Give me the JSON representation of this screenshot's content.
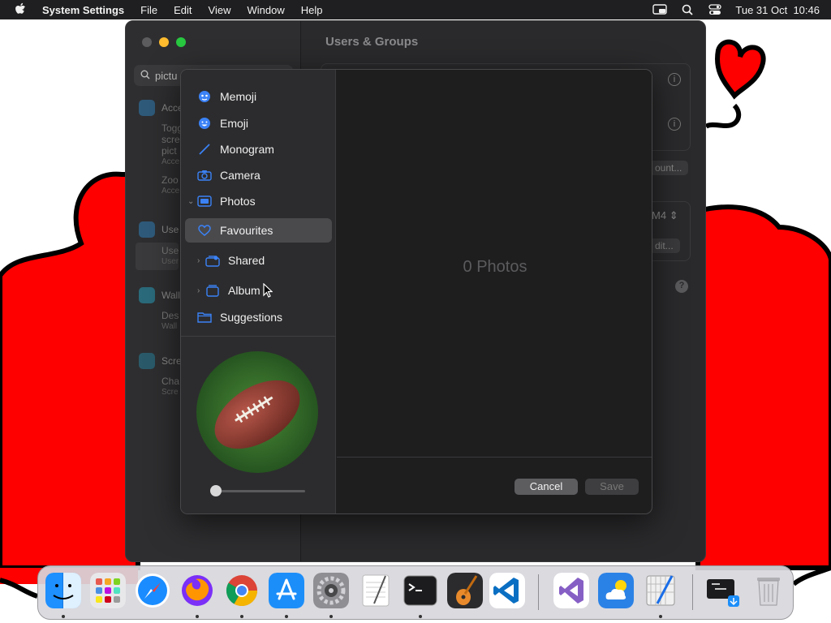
{
  "menubar": {
    "app_name": "System Settings",
    "items": [
      "File",
      "Edit",
      "View",
      "Window",
      "Help"
    ],
    "clock": "Tue 31 Oct  10:46"
  },
  "settings_window": {
    "title": "Users & Groups",
    "search_value": "pictu",
    "sections": [
      {
        "head": "Acce",
        "lines": [
          {
            "t": "Togg"
          },
          {
            "t": "scre"
          },
          {
            "t": "pict"
          },
          {
            "t": "Acce",
            "small": true
          },
          {
            "t": "Zoo"
          },
          {
            "t": "Acce",
            "small": true
          }
        ]
      },
      {
        "head": "Use",
        "lines": [
          {
            "t": "Use"
          },
          {
            "t": "User",
            "small": true
          }
        ]
      },
      {
        "head": "Wall",
        "lines": [
          {
            "t": "Des"
          },
          {
            "t": "Wall",
            "small": true
          }
        ]
      },
      {
        "head": "Scre",
        "lines": [
          {
            "t": "Cha"
          },
          {
            "t": "Scre",
            "small": true
          }
        ]
      }
    ],
    "add_account_label": "ount...",
    "version_label": "M4",
    "edit_label": "dit...",
    "help_label": "?"
  },
  "picker": {
    "nav": [
      {
        "label": "Memoji",
        "icon": "memoji-icon"
      },
      {
        "label": "Emoji",
        "icon": "emoji-icon"
      },
      {
        "label": "Monogram",
        "icon": "monogram-icon"
      },
      {
        "label": "Camera",
        "icon": "camera-icon"
      },
      {
        "label": "Photos",
        "icon": "photos-icon"
      },
      {
        "label": "Favourites",
        "icon": "heart-icon"
      },
      {
        "label": "Shared",
        "icon": "shared-album-icon"
      },
      {
        "label": "Album",
        "icon": "album-icon"
      },
      {
        "label": "Suggestions",
        "icon": "folder-icon"
      }
    ],
    "empty_message": "0 Photos",
    "cancel_label": "Cancel",
    "save_label": "Save",
    "zoom_level": 0
  },
  "dock": {
    "apps": [
      "Finder",
      "Launchpad",
      "Safari",
      "Firefox",
      "Chrome",
      "App Store",
      "System Settings",
      "TextEdit",
      "Terminal",
      "GarageBand",
      "Visual Studio Code",
      "Visual Studio",
      "Weather",
      "Script Editor",
      "Downloads",
      "Trash"
    ]
  },
  "colors": {
    "accent": "#3b82f6",
    "wallpaper_red": "#ff0000"
  }
}
